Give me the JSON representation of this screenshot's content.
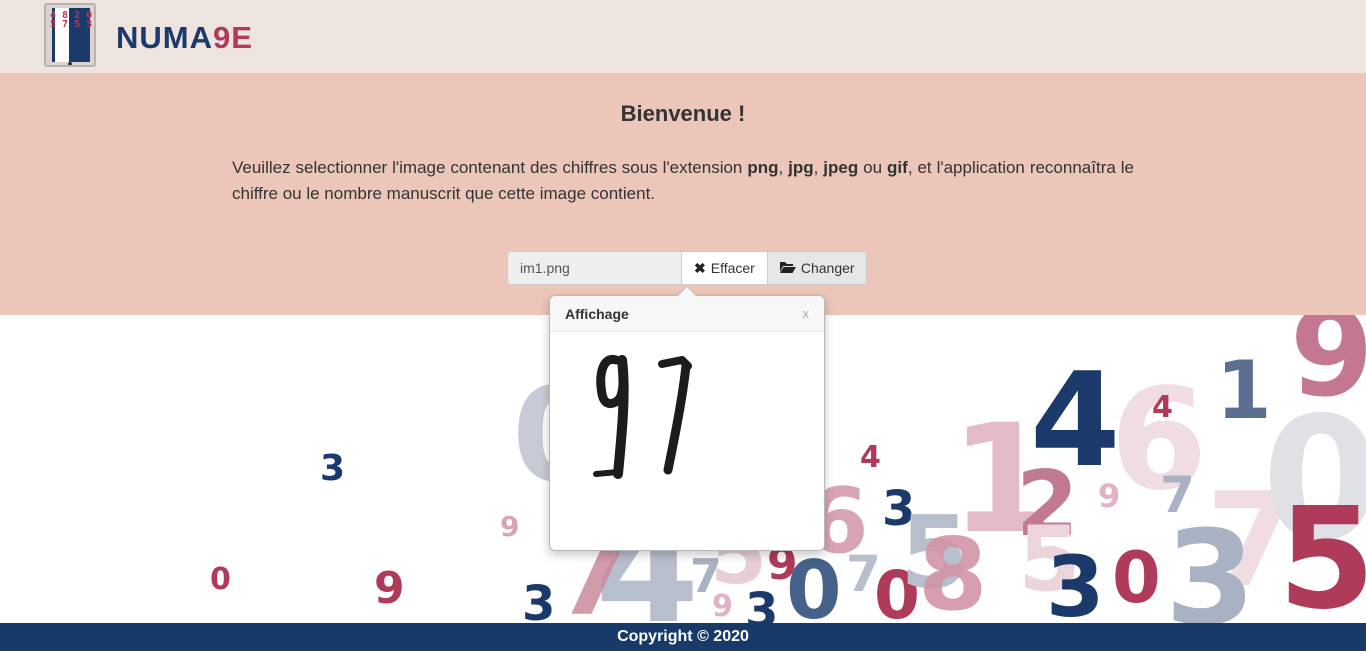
{
  "header": {
    "brand": {
      "main": "NUMA",
      "accent": "9E"
    },
    "logo_digits": "4 8 2 0 5 7 5 3"
  },
  "hero": {
    "title": "Bienvenue !",
    "description": {
      "t1": "Veuillez selectionner l'image contenant des chiffres sous l'extension ",
      "ext1": "png",
      "t2": ", ",
      "ext2": "jpg",
      "t3": ", ",
      "ext3": "jpeg",
      "t4": " ou ",
      "ext4": "gif",
      "t5": ", et l'application reconnaîtra le chiffre ou le nombre manuscrit que cette image contient."
    }
  },
  "upload": {
    "filename": "im1.png",
    "clear_label": "Effacer",
    "change_label": "Changer",
    "clear_icon": "times-icon",
    "change_icon": "folder-open-icon"
  },
  "popover": {
    "title": "Affichage",
    "close_label": "x"
  },
  "footer": {
    "copyright": "Copyright © 2020"
  },
  "colors": {
    "header_bg": "#ede3df",
    "hero_bg": "#ecc6b8",
    "navy": "#1b3a6b",
    "crimson": "#b03a5a",
    "footer_bg": "#173a68"
  },
  "background_numbers": [
    {
      "text": "0",
      "color": "#c7cbd5"
    },
    {
      "text": "3",
      "color": "#1b3a6b"
    },
    {
      "text": "9",
      "color": "#d8a4b3"
    },
    {
      "text": "0",
      "color": "#b03a5a"
    },
    {
      "text": "9",
      "color": "#b03a5a"
    },
    {
      "text": "3",
      "color": "#1b3a6b"
    },
    {
      "text": "4",
      "color": "#b8bfcc"
    },
    {
      "text": "7",
      "color": "#c98a9c"
    },
    {
      "text": "7",
      "color": "#a9b2c2"
    },
    {
      "text": "5",
      "color": "#e9cdd5"
    },
    {
      "text": "9",
      "color": "#dfb3c0"
    },
    {
      "text": "3",
      "color": "#1b3a6b"
    },
    {
      "text": "9",
      "color": "#b03a5a"
    },
    {
      "text": "6",
      "color": "#d8a4b3"
    },
    {
      "text": "0",
      "color": "#46628b"
    },
    {
      "text": "7",
      "color": "#b8bfcc"
    },
    {
      "text": "0",
      "color": "#b03a5a"
    },
    {
      "text": "3",
      "color": "#1b3a6b"
    },
    {
      "text": "4",
      "color": "#b03a5a"
    },
    {
      "text": "5",
      "color": "#b8bfcc"
    },
    {
      "text": "8",
      "color": "#d294a6"
    },
    {
      "text": "1",
      "color": "#deb0be"
    },
    {
      "text": "2",
      "color": "#c17a91"
    },
    {
      "text": "5",
      "color": "#ecd4db"
    },
    {
      "text": "3",
      "color": "#1b3a6b"
    },
    {
      "text": "4",
      "color": "#1b3a6b"
    },
    {
      "text": "0",
      "color": "#b03a5a"
    },
    {
      "text": "9",
      "color": "#dfb3c0"
    },
    {
      "text": "6",
      "color": "#efdde3"
    },
    {
      "text": "4",
      "color": "#b03a5a"
    },
    {
      "text": "1",
      "color": "#5a6f92"
    },
    {
      "text": "7",
      "color": "#a9b2c2"
    },
    {
      "text": "7",
      "color": "#efdde3"
    },
    {
      "text": "3",
      "color": "#a9b2c2"
    },
    {
      "text": "9",
      "color": "#c4788f"
    },
    {
      "text": "0",
      "color": "#dfe1e6"
    },
    {
      "text": "5",
      "color": "#b03a5a"
    }
  ]
}
